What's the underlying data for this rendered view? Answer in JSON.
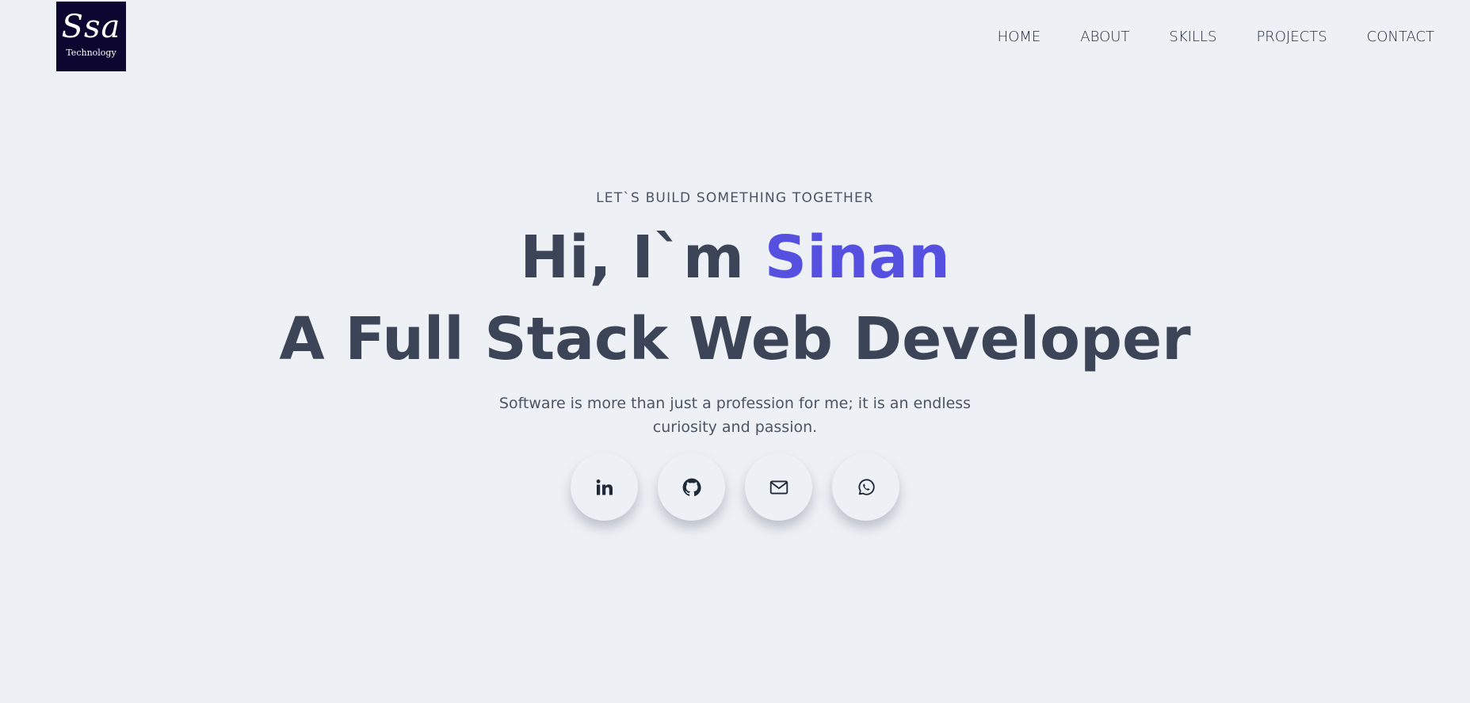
{
  "logo": {
    "mark": "Ssa",
    "sub": "Technology",
    "background": "#0d0630"
  },
  "nav": {
    "items": [
      {
        "label": "HOME"
      },
      {
        "label": "ABOUT"
      },
      {
        "label": "SKILLS"
      },
      {
        "label": "PROJECTS"
      },
      {
        "label": "CONTACT"
      }
    ]
  },
  "hero": {
    "kicker": "LET`S BUILD SOMETHING TOGETHER",
    "greeting": "Hi, I`m ",
    "name": "Sinan",
    "role": "A Full Stack Web Developer",
    "tagline": "Software is more than just a profession for me; it is an endless curiosity and passion."
  },
  "socials": [
    {
      "icon": "linkedin-icon"
    },
    {
      "icon": "github-icon"
    },
    {
      "icon": "mail-icon"
    },
    {
      "icon": "whatsapp-icon"
    }
  ],
  "colors": {
    "background": "#edf0f4",
    "accent": "#5650e0",
    "heading": "#3b4557",
    "text": "#4b5563"
  }
}
